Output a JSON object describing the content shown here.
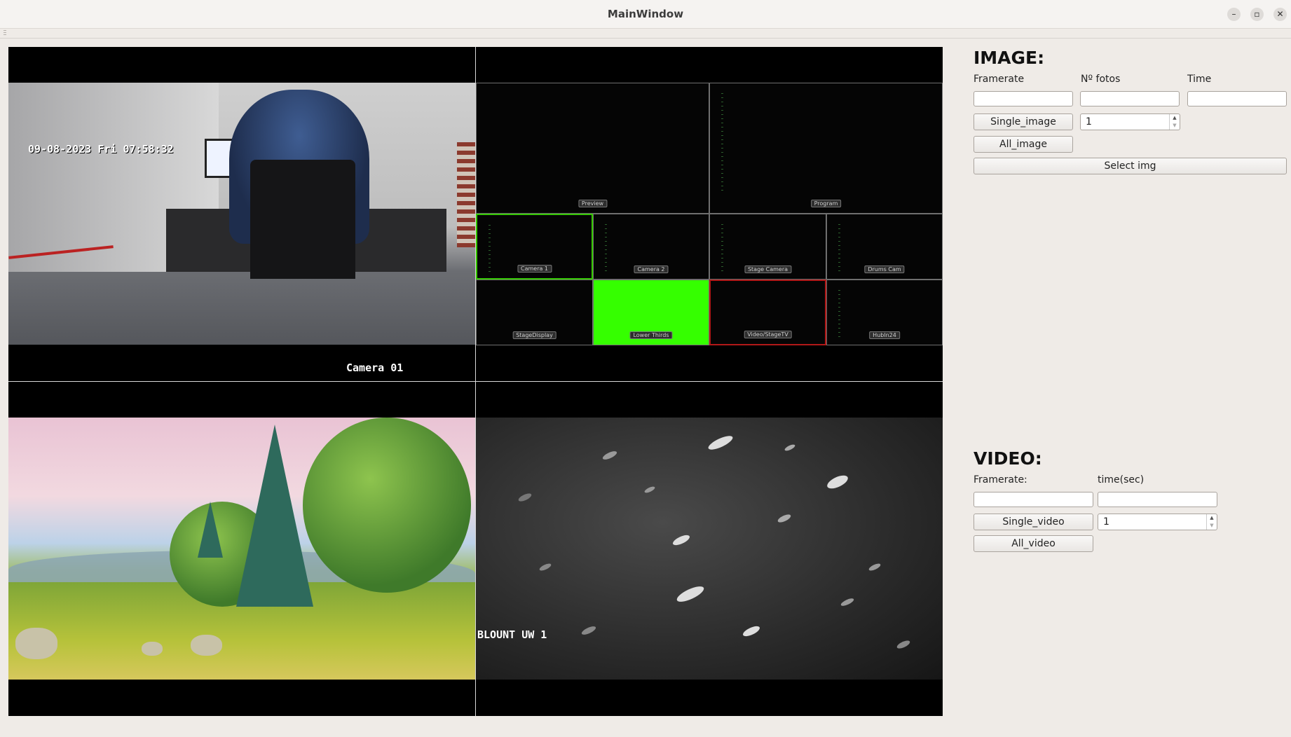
{
  "window": {
    "title": "MainWindow"
  },
  "panes": {
    "cam1": {
      "timestamp": "09-08-2023 Fri 07:58:32",
      "label": "Camera 01"
    },
    "multiview": {
      "tiles": [
        "Preview",
        "Program",
        "Camera 1",
        "Camera 2",
        "Stage Camera",
        "Drums Cam",
        "StageDisplay",
        "Lower Thirds",
        "Video/StageTV",
        "Hubln24"
      ],
      "accent": "#35ff00"
    },
    "uw": {
      "label": "BLOUNT UW 1"
    }
  },
  "image": {
    "heading": "IMAGE:",
    "framerate_label": "Framerate",
    "nfotos_label": "Nº fotos",
    "time_label": "Time",
    "framerate_value": "",
    "nfotos_value": "",
    "time_value": "",
    "single_button": "Single_image",
    "single_spin_value": "1",
    "all_button": "All_image",
    "select_button": "Select img"
  },
  "video": {
    "heading": "VIDEO:",
    "framerate_label": "Framerate:",
    "time_label": "time(sec)",
    "framerate_value": "",
    "time_value": "",
    "single_button": "Single_video",
    "single_spin_value": "1",
    "all_button": "All_video"
  },
  "icons": {
    "minimize": "minimize-icon",
    "maximize": "maximize-icon",
    "close": "close-icon"
  }
}
